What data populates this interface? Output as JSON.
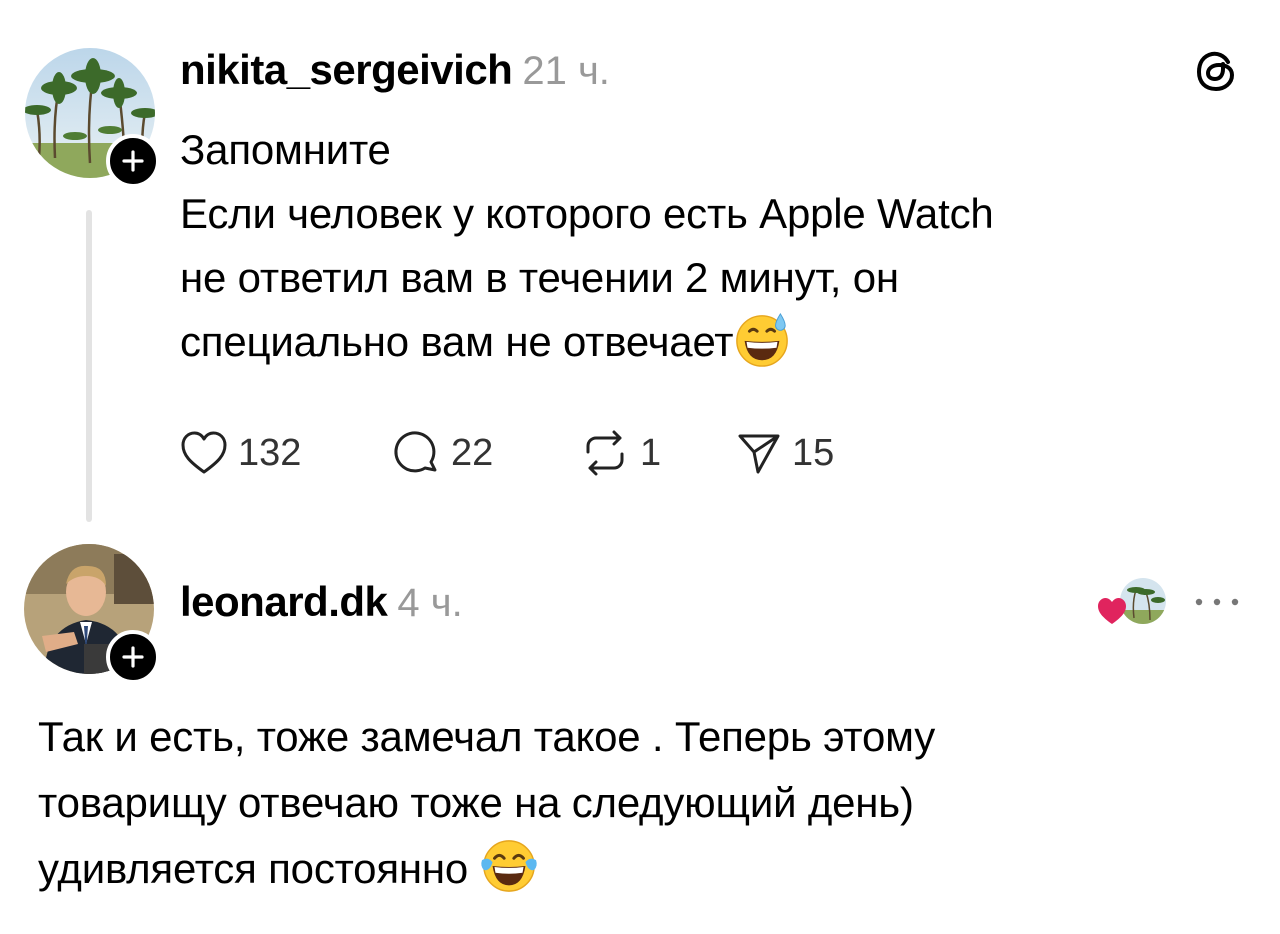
{
  "post": {
    "username": "nikita_sergeivich",
    "timestamp": "21 ч.",
    "lines": [
      "Запомните",
      "Если человек у которого есть Apple Watch",
      "не ответил вам в течении 2 минут, он",
      "специально вам не отвечает"
    ],
    "emoji": "grinning-face-with-sweat",
    "actions": {
      "likes": "132",
      "comments": "22",
      "reposts": "1",
      "shares": "15"
    }
  },
  "reply": {
    "username": "leonard.dk",
    "timestamp": "4 ч.",
    "lines": [
      "Так и есть, тоже замечал такое . Теперь этому",
      "товарищу отвечаю тоже на следующий день)",
      "удивляется постоянно"
    ],
    "emoji": "face-with-tears-of-joy"
  },
  "colors": {
    "accent": "#000000",
    "muted": "#999999",
    "like_red": "#e0245e",
    "thread_line": "#e3e3e3"
  }
}
